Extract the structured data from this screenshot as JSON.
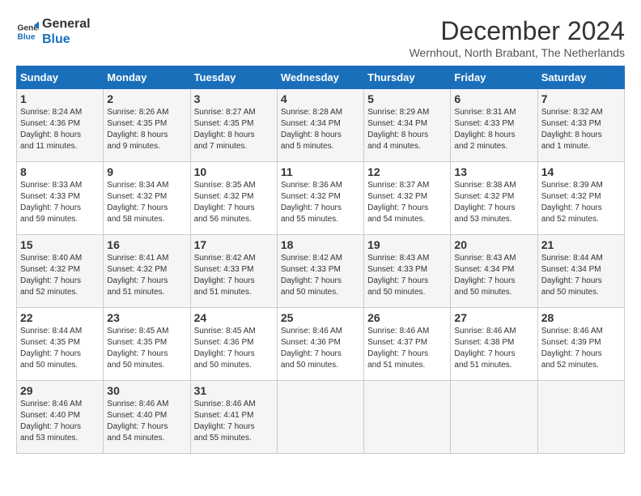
{
  "logo": {
    "line1": "General",
    "line2": "Blue"
  },
  "title": "December 2024",
  "subtitle": "Wernhout, North Brabant, The Netherlands",
  "header_row": [
    "Sunday",
    "Monday",
    "Tuesday",
    "Wednesday",
    "Thursday",
    "Friday",
    "Saturday"
  ],
  "weeks": [
    [
      {
        "day": "1",
        "info": "Sunrise: 8:24 AM\nSunset: 4:36 PM\nDaylight: 8 hours\nand 11 minutes."
      },
      {
        "day": "2",
        "info": "Sunrise: 8:26 AM\nSunset: 4:35 PM\nDaylight: 8 hours\nand 9 minutes."
      },
      {
        "day": "3",
        "info": "Sunrise: 8:27 AM\nSunset: 4:35 PM\nDaylight: 8 hours\nand 7 minutes."
      },
      {
        "day": "4",
        "info": "Sunrise: 8:28 AM\nSunset: 4:34 PM\nDaylight: 8 hours\nand 5 minutes."
      },
      {
        "day": "5",
        "info": "Sunrise: 8:29 AM\nSunset: 4:34 PM\nDaylight: 8 hours\nand 4 minutes."
      },
      {
        "day": "6",
        "info": "Sunrise: 8:31 AM\nSunset: 4:33 PM\nDaylight: 8 hours\nand 2 minutes."
      },
      {
        "day": "7",
        "info": "Sunrise: 8:32 AM\nSunset: 4:33 PM\nDaylight: 8 hours\nand 1 minute."
      }
    ],
    [
      {
        "day": "8",
        "info": "Sunrise: 8:33 AM\nSunset: 4:33 PM\nDaylight: 7 hours\nand 59 minutes."
      },
      {
        "day": "9",
        "info": "Sunrise: 8:34 AM\nSunset: 4:32 PM\nDaylight: 7 hours\nand 58 minutes."
      },
      {
        "day": "10",
        "info": "Sunrise: 8:35 AM\nSunset: 4:32 PM\nDaylight: 7 hours\nand 56 minutes."
      },
      {
        "day": "11",
        "info": "Sunrise: 8:36 AM\nSunset: 4:32 PM\nDaylight: 7 hours\nand 55 minutes."
      },
      {
        "day": "12",
        "info": "Sunrise: 8:37 AM\nSunset: 4:32 PM\nDaylight: 7 hours\nand 54 minutes."
      },
      {
        "day": "13",
        "info": "Sunrise: 8:38 AM\nSunset: 4:32 PM\nDaylight: 7 hours\nand 53 minutes."
      },
      {
        "day": "14",
        "info": "Sunrise: 8:39 AM\nSunset: 4:32 PM\nDaylight: 7 hours\nand 52 minutes."
      }
    ],
    [
      {
        "day": "15",
        "info": "Sunrise: 8:40 AM\nSunset: 4:32 PM\nDaylight: 7 hours\nand 52 minutes."
      },
      {
        "day": "16",
        "info": "Sunrise: 8:41 AM\nSunset: 4:32 PM\nDaylight: 7 hours\nand 51 minutes."
      },
      {
        "day": "17",
        "info": "Sunrise: 8:42 AM\nSunset: 4:33 PM\nDaylight: 7 hours\nand 51 minutes."
      },
      {
        "day": "18",
        "info": "Sunrise: 8:42 AM\nSunset: 4:33 PM\nDaylight: 7 hours\nand 50 minutes."
      },
      {
        "day": "19",
        "info": "Sunrise: 8:43 AM\nSunset: 4:33 PM\nDaylight: 7 hours\nand 50 minutes."
      },
      {
        "day": "20",
        "info": "Sunrise: 8:43 AM\nSunset: 4:34 PM\nDaylight: 7 hours\nand 50 minutes."
      },
      {
        "day": "21",
        "info": "Sunrise: 8:44 AM\nSunset: 4:34 PM\nDaylight: 7 hours\nand 50 minutes."
      }
    ],
    [
      {
        "day": "22",
        "info": "Sunrise: 8:44 AM\nSunset: 4:35 PM\nDaylight: 7 hours\nand 50 minutes."
      },
      {
        "day": "23",
        "info": "Sunrise: 8:45 AM\nSunset: 4:35 PM\nDaylight: 7 hours\nand 50 minutes."
      },
      {
        "day": "24",
        "info": "Sunrise: 8:45 AM\nSunset: 4:36 PM\nDaylight: 7 hours\nand 50 minutes."
      },
      {
        "day": "25",
        "info": "Sunrise: 8:46 AM\nSunset: 4:36 PM\nDaylight: 7 hours\nand 50 minutes."
      },
      {
        "day": "26",
        "info": "Sunrise: 8:46 AM\nSunset: 4:37 PM\nDaylight: 7 hours\nand 51 minutes."
      },
      {
        "day": "27",
        "info": "Sunrise: 8:46 AM\nSunset: 4:38 PM\nDaylight: 7 hours\nand 51 minutes."
      },
      {
        "day": "28",
        "info": "Sunrise: 8:46 AM\nSunset: 4:39 PM\nDaylight: 7 hours\nand 52 minutes."
      }
    ],
    [
      {
        "day": "29",
        "info": "Sunrise: 8:46 AM\nSunset: 4:40 PM\nDaylight: 7 hours\nand 53 minutes."
      },
      {
        "day": "30",
        "info": "Sunrise: 8:46 AM\nSunset: 4:40 PM\nDaylight: 7 hours\nand 54 minutes."
      },
      {
        "day": "31",
        "info": "Sunrise: 8:46 AM\nSunset: 4:41 PM\nDaylight: 7 hours\nand 55 minutes."
      },
      {
        "day": "",
        "info": ""
      },
      {
        "day": "",
        "info": ""
      },
      {
        "day": "",
        "info": ""
      },
      {
        "day": "",
        "info": ""
      }
    ]
  ]
}
